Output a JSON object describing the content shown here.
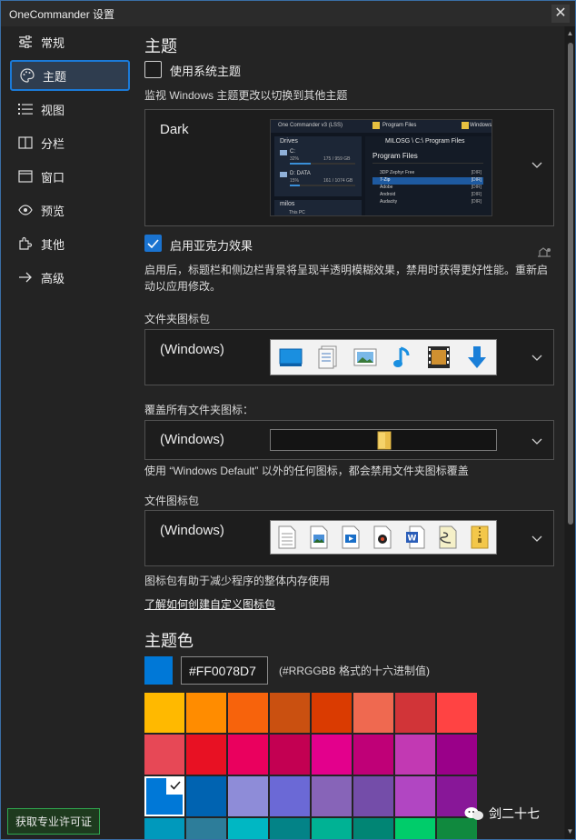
{
  "window": {
    "title": "OneCommander 设置",
    "close": "✕"
  },
  "sidebar": {
    "items": [
      {
        "label": "常规",
        "icon": "sliders-icon"
      },
      {
        "label": "主题",
        "icon": "palette-icon"
      },
      {
        "label": "视图",
        "icon": "list-view-icon"
      },
      {
        "label": "分栏",
        "icon": "columns-icon"
      },
      {
        "label": "窗口",
        "icon": "window-icon"
      },
      {
        "label": "预览",
        "icon": "eye-icon"
      },
      {
        "label": "其他",
        "icon": "puzzle-icon"
      },
      {
        "label": "高级",
        "icon": "arrow-right-icon"
      }
    ],
    "active_index": 1,
    "license_button": "获取专业许可证"
  },
  "theme": {
    "heading": "主题",
    "use_system_theme_label": "使用系统主题",
    "use_system_theme_checked": false,
    "monitor_text": "监视 Windows 主题更改以切换到其他主题",
    "selected_theme": "Dark",
    "preview": {
      "app_title": "One Commander v3 (LSS)",
      "tab1": "Program Files",
      "tab2": "Windows",
      "drives_label": "Drives",
      "drive_c": "C:",
      "drive_c_pct": "32%",
      "drive_c_size": "175 / 959 GB",
      "drive_d": "D: DATA",
      "drive_d_pct": "15%",
      "drive_d_size": "161 / 1074 GB",
      "path": "MILOSG \\ C:\\ Program Files",
      "folder_title": "Program Files",
      "user": "milos",
      "this_pc": "This PC",
      "rows": [
        {
          "name": "3DP Zephyr Free",
          "tag": "[DIR]"
        },
        {
          "name": "7-Zip",
          "tag": "[DIR]"
        },
        {
          "name": "Adobe",
          "tag": "[DIR]"
        },
        {
          "name": "Android",
          "tag": "[DIR]"
        },
        {
          "name": "Audacity",
          "tag": "[DIR]"
        }
      ]
    },
    "acrylic_label": "启用亚克力效果",
    "acrylic_checked": true,
    "acrylic_desc_line1": "启用后，标题栏和侧边栏背景将呈现半透明模糊效果，禁用时获得更好性能。重新启",
    "acrylic_desc_line2": "动以应用修改。",
    "folder_icon_pack_label": "文件夹图标包",
    "folder_icon_pack_value": "(Windows)",
    "override_label": "覆盖所有文件夹图标：",
    "override_value": "(Windows)",
    "override_note": "使用 “Windows Default” 以外的任何图标，都会禁用文件夹图标覆盖",
    "file_icon_pack_label": "文件图标包",
    "file_icon_pack_value": "(Windows)",
    "icon_pack_note": "图标包有助于减少程序的整体内存使用",
    "custom_pack_link": "了解如何创建自定义图标包"
  },
  "theme_color": {
    "heading": "主题色",
    "current": "#0078D7",
    "hex_value": "#FF0078D7",
    "hex_hint": "(#RRGGBB 格式的十六进制值)",
    "swatches": [
      [
        "#FFB900",
        "#FF8C00",
        "#F7630C",
        "#CA5010",
        "#DA3B01",
        "#EF6950",
        "#D13438",
        "#FF4343"
      ],
      [
        "#E74856",
        "#E81123",
        "#EA005E",
        "#C30052",
        "#E3008C",
        "#BF0077",
        "#C239B3",
        "#9A0089"
      ],
      [
        "#0078D7",
        "#0063B1",
        "#8E8CD8",
        "#6B69D6",
        "#8764B8",
        "#744DA9",
        "#B146C2",
        "#881798"
      ],
      [
        "#0099BC",
        "#2D7D9A",
        "#00B7C3",
        "#038387",
        "#00B294",
        "#018574",
        "#00CC6A",
        "#10893E"
      ]
    ],
    "selected_swatch": "#0078D7"
  },
  "watermark": "剑二十七"
}
